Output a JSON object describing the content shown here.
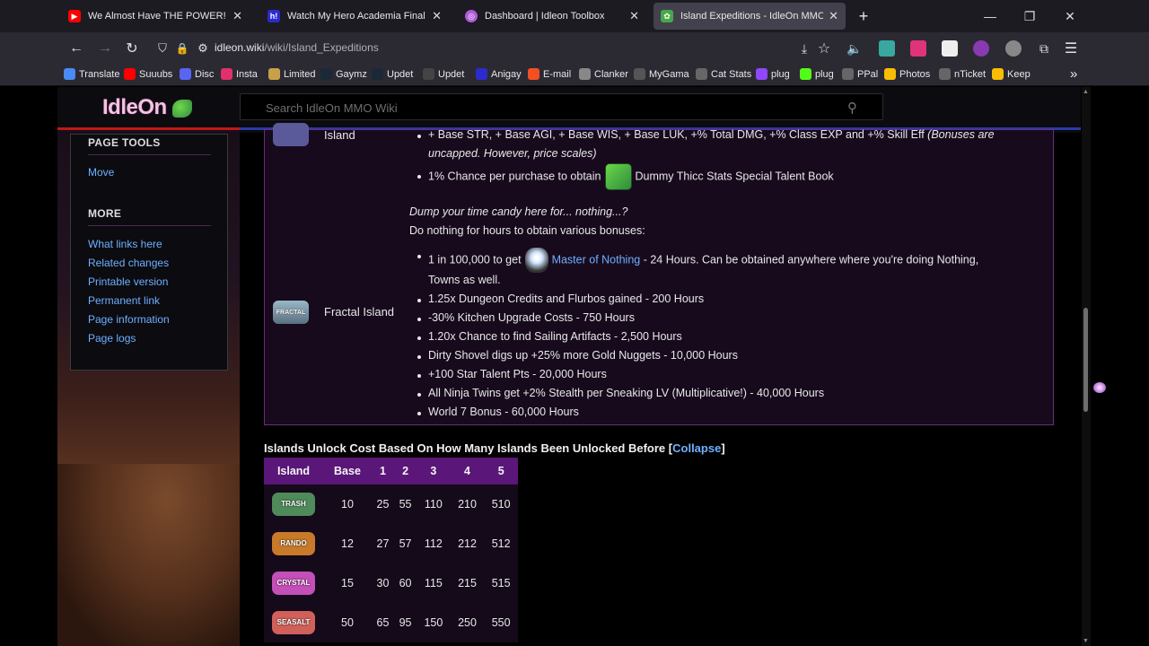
{
  "browser": {
    "tabs": [
      {
        "title": "We Almost Have THE POWER! | IdleOn",
        "color": "#ff0000",
        "glyph": "▶"
      },
      {
        "title": "Watch My Hero Academia Final Season",
        "color": "#2b2bd0",
        "glyph": "h!"
      },
      {
        "title": "Dashboard | Idleon Toolbox",
        "color": "#b05ad8",
        "glyph": "◎"
      },
      {
        "title": "Island Expeditions - IdleOn MMO Wiki",
        "color": "#47a84a",
        "glyph": "✿"
      }
    ],
    "new_tab": "+",
    "url_host": "idleon.wiki",
    "url_path": "/wiki/Island_Expeditions",
    "bookmarks": [
      {
        "label": "Translate",
        "color": "#4a8af4"
      },
      {
        "label": "Suuubs",
        "color": "#ff0000"
      },
      {
        "label": "Disc",
        "color": "#5865f2"
      },
      {
        "label": "Insta",
        "color": "#e1306c"
      },
      {
        "label": "Limited",
        "color": "#c9a04a"
      },
      {
        "label": "Gaymz",
        "color": "#1b2838"
      },
      {
        "label": "Updet",
        "color": "#1b2838"
      },
      {
        "label": "Updet",
        "color": "#444444"
      },
      {
        "label": "Anigay",
        "color": "#2b2bd0"
      },
      {
        "label": "E-mail",
        "color": "#f25022"
      },
      {
        "label": "Clanker",
        "color": "#888888"
      },
      {
        "label": "MyGama",
        "color": "#555555"
      },
      {
        "label": "Cat Stats",
        "color": "#666666"
      },
      {
        "label": "plug",
        "color": "#9146ff"
      },
      {
        "label": "plug",
        "color": "#53fc18"
      },
      {
        "label": "PPal",
        "color": "#666666"
      },
      {
        "label": "Photos",
        "color": "#fbbc05"
      },
      {
        "label": "nTicket",
        "color": "#666666"
      },
      {
        "label": "Keep",
        "color": "#fbbc04"
      }
    ]
  },
  "wiki": {
    "logo": "IdleOn",
    "search_placeholder": "Search IdleOn MMO Wiki",
    "sidebar": {
      "page_tools_title": "PAGE TOOLS",
      "page_tools": [
        "Move"
      ],
      "more_title": "MORE",
      "more": [
        "What links here",
        "Related changes",
        "Printable version",
        "Permanent link",
        "Page information",
        "Page logs"
      ]
    }
  },
  "islands": {
    "prev_island_name": "Island",
    "prev_bullets": [
      {
        "text": "+ Base STR, + Base AGI, + Base WIS, + Base LUK, +% Total DMG, +% Class EXP and +% Skill Eff",
        "note": "(Bonuses are",
        "note2": "uncapped. However, price scales)"
      },
      {
        "pre": "1% Chance per purchase to obtain",
        "post": "Dummy Thicc Stats Special Talent Book"
      }
    ],
    "fractal": {
      "name": "Fractal Island",
      "icon_text": "FRACTAL",
      "intro_italic": "Dump your time candy here for... nothing...?",
      "intro": "Do nothing for hours to obtain various bonuses:",
      "first_pre": "1 in 100,000 to get",
      "first_link": "Master of Nothing",
      "first_post": "- 24 Hours. Can be obtained anywhere where you're doing Nothing,",
      "first_cont": "Towns as well.",
      "bullets": [
        "1.25x Dungeon Credits and Flurbos gained - 200 Hours",
        "-30% Kitchen Upgrade Costs - 750 Hours",
        "1.20x Chance to find Sailing Artifacts - 2,500 Hours",
        "Dirty Shovel digs up +25% more Gold Nuggets - 10,000 Hours",
        "+100 Star Talent Pts - 20,000 Hours",
        "All Ninja Twins get +2% Stealth per Sneaking LV (Multiplicative!) - 40,000 Hours",
        "World 7 Bonus - 60,000 Hours"
      ]
    }
  },
  "cost_section": {
    "title": "Islands Unlock Cost Based On How Many Islands Been Unlocked Before",
    "collapse": "Collapse",
    "headers": [
      "Island",
      "Base",
      "1",
      "2",
      "3",
      "4",
      "5"
    ],
    "rows": [
      {
        "icon": "TRASH",
        "color": "#4f8a5a",
        "values": [
          "10",
          "25",
          "55",
          "110",
          "210",
          "510"
        ]
      },
      {
        "icon": "RANDO",
        "color": "#c87a2a",
        "values": [
          "12",
          "27",
          "57",
          "112",
          "212",
          "512"
        ]
      },
      {
        "icon": "CRYSTAL",
        "color": "#c44fb8",
        "values": [
          "15",
          "30",
          "60",
          "115",
          "215",
          "515"
        ]
      },
      {
        "icon": "SEASALT",
        "color": "#d0605a",
        "values": [
          "50",
          "65",
          "95",
          "150",
          "250",
          "550"
        ]
      }
    ]
  }
}
